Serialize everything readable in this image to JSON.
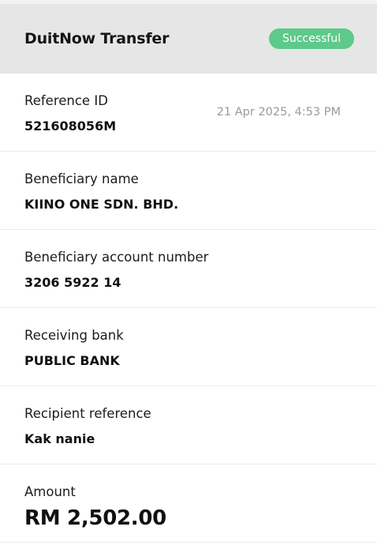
{
  "header": {
    "title": "DuitNow Transfer",
    "status": "Successful",
    "status_color": "#5dc98a",
    "background": "#e6e6e6"
  },
  "details": {
    "reference": {
      "label": "Reference ID",
      "value": "521608056M",
      "timestamp": "21 Apr 2025, 4:53 PM"
    },
    "beneficiary_name": {
      "label": "Beneficiary name",
      "value": "KIINO ONE SDN. BHD."
    },
    "account_number": {
      "label": "Beneficiary account number",
      "value": "3206 5922 14"
    },
    "receiving_bank": {
      "label": "Receiving bank",
      "value": "PUBLIC BANK"
    },
    "recipient_reference": {
      "label": "Recipient reference",
      "value": "Kak nanie"
    },
    "amount": {
      "label": "Amount",
      "value": "RM 2,502.00"
    }
  }
}
